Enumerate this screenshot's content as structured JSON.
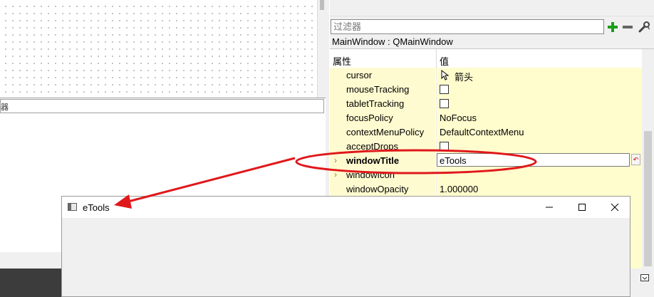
{
  "filter": {
    "placeholder": "过滤器"
  },
  "object_line": "MainWindow : QMainWindow",
  "header": {
    "property": "属性",
    "value": "值"
  },
  "rows": [
    {
      "name": "cursor",
      "value": "箭头",
      "kind": "cursor"
    },
    {
      "name": "mouseTracking",
      "value": "",
      "kind": "checkbox"
    },
    {
      "name": "tabletTracking",
      "value": "",
      "kind": "checkbox"
    },
    {
      "name": "focusPolicy",
      "value": "NoFocus",
      "kind": "text"
    },
    {
      "name": "contextMenuPolicy",
      "value": "DefaultContextMenu",
      "kind": "text"
    },
    {
      "name": "acceptDrops",
      "value": "",
      "kind": "checkbox"
    },
    {
      "name": "windowTitle",
      "value": "eTools",
      "kind": "edit"
    },
    {
      "name": "windowIcon",
      "value": "",
      "kind": "expand"
    },
    {
      "name": "windowOpacity",
      "value": "1.000000",
      "kind": "text"
    }
  ],
  "window": {
    "title": "eTools"
  },
  "lower_field_label": "器",
  "icons": {
    "add": "plus-icon",
    "remove": "minus-icon",
    "config": "wrench-icon",
    "cursor": "arrow-cursor-icon",
    "reset": "reset-icon",
    "minimize": "minimize-icon",
    "maximize": "maximize-icon",
    "close": "close-icon"
  },
  "colors": {
    "row_bg": "#fffccd",
    "annotation": "#e0181b",
    "add_green": "#1a9e1a"
  }
}
